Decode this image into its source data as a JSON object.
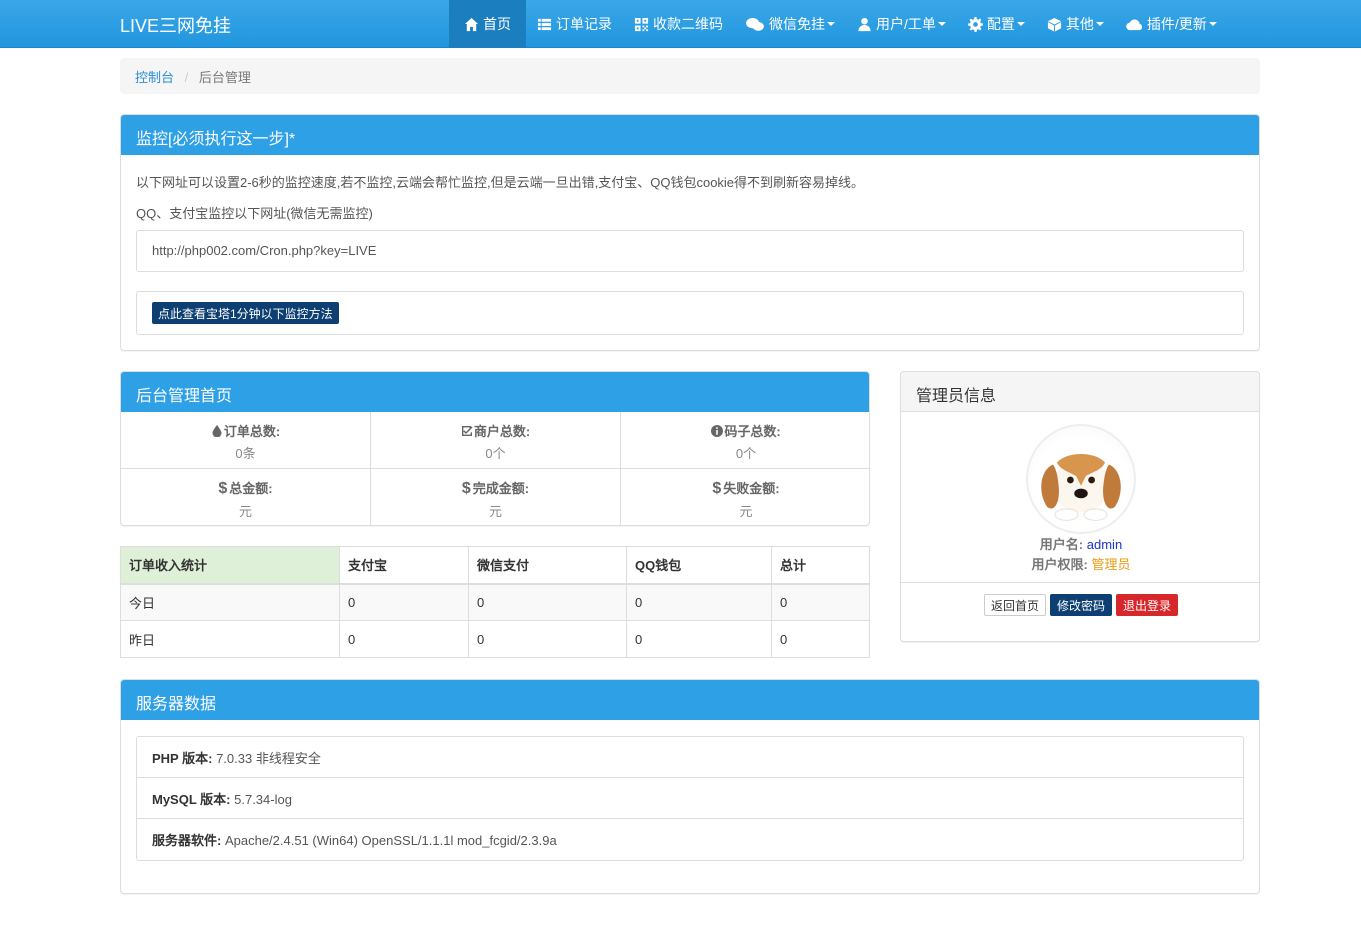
{
  "navbar": {
    "brand": "LIVE三网免挂",
    "items": [
      {
        "label": "首页",
        "icon": "home-icon",
        "dropdown": false,
        "active": true
      },
      {
        "label": "订单记录",
        "icon": "list-icon",
        "dropdown": false,
        "active": false
      },
      {
        "label": "收款二维码",
        "icon": "qrcode-icon",
        "dropdown": false,
        "active": false
      },
      {
        "label": "微信免挂",
        "icon": "wechat-icon",
        "dropdown": true,
        "active": false
      },
      {
        "label": "用户/工单",
        "icon": "user-icon",
        "dropdown": true,
        "active": false
      },
      {
        "label": "配置",
        "icon": "gear-icon",
        "dropdown": true,
        "active": false
      },
      {
        "label": "其他",
        "icon": "cube-icon",
        "dropdown": true,
        "active": false
      },
      {
        "label": "插件/更新",
        "icon": "cloud-icon",
        "dropdown": true,
        "active": false
      }
    ]
  },
  "breadcrumb": {
    "home": "控制台",
    "current": "后台管理"
  },
  "monitor": {
    "title": "监控[必须执行这一步]*",
    "description": "以下网址可以设置2-6秒的监控速度,若不监控,云端会帮忙监控,但是云端一旦出错,支付宝、QQ钱包cookie得不到刷新容易掉线。",
    "subtitle": "QQ、支付宝监控以下网址(微信无需监控)",
    "url": "http://php002.com/Cron.php?key=LIVE",
    "button": "点此查看宝塔1分钟以下监控方法"
  },
  "home": {
    "title": "后台管理首页",
    "stats": [
      {
        "label": "订单总数:",
        "value": "0条",
        "icon": "tint-icon"
      },
      {
        "label": "商户总数:",
        "value": "0个",
        "icon": "check-square-icon"
      },
      {
        "label": "码子总数:",
        "value": "0个",
        "icon": "info-circle-icon"
      },
      {
        "label": "总金额:",
        "value": "元",
        "icon": "dollar-icon"
      },
      {
        "label": "完成金额:",
        "value": "元",
        "icon": "dollar-icon"
      },
      {
        "label": "失败金额:",
        "value": "元",
        "icon": "dollar-icon"
      }
    ]
  },
  "income": {
    "headers": [
      "订单收入统计",
      "支付宝",
      "微信支付",
      "QQ钱包",
      "总计"
    ],
    "rows": [
      [
        "今日",
        "0",
        "0",
        "0",
        "0"
      ],
      [
        "昨日",
        "0",
        "0",
        "0",
        "0"
      ]
    ]
  },
  "admin": {
    "title": "管理员信息",
    "username_label": "用户名:",
    "username": "admin",
    "role_label": "用户权限:",
    "role": "管理员",
    "buttons": {
      "home": "返回首页",
      "password": "修改密码",
      "logout": "退出登录"
    }
  },
  "server": {
    "title": "服务器数据",
    "items": [
      {
        "label": "PHP 版本:",
        "value": "7.0.33 非线程安全"
      },
      {
        "label": "MySQL 版本:",
        "value": "5.7.34-log"
      },
      {
        "label": "服务器软件:",
        "value": "Apache/2.4.51 (Win64) OpenSSL/1.1.1l mod_fcgid/2.3.9a"
      }
    ]
  },
  "colors": {
    "primary": "#2ea0e6",
    "navbar": "#2196de",
    "dark_button": "#0d3f73",
    "danger": "#d9262a",
    "role": "#e89a10"
  }
}
